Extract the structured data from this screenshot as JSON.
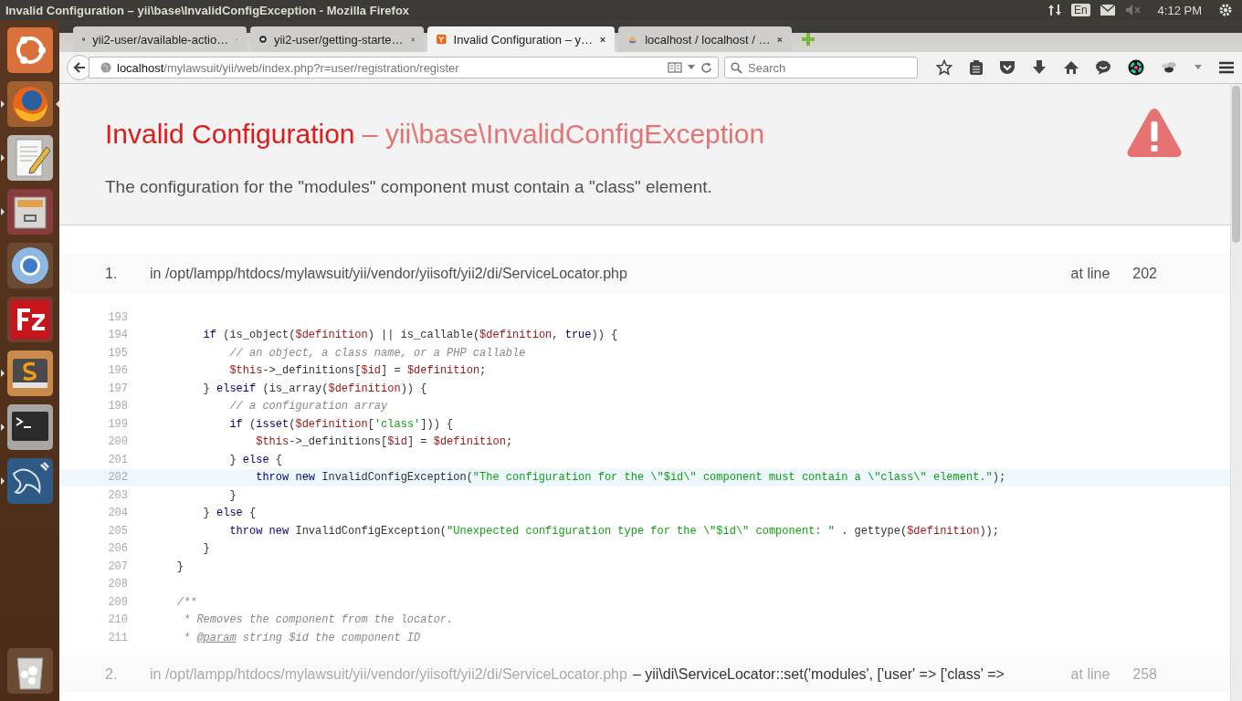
{
  "system_bar": {
    "title": "Invalid Configuration – yii\\base\\InvalidConfigException - Mozilla Firefox",
    "keyboard": "En",
    "clock": "4:12 PM"
  },
  "launcher": [
    {
      "kind": "home",
      "running": false,
      "focused": false
    },
    {
      "kind": "firefox",
      "running": true,
      "focused": true
    },
    {
      "kind": "editor",
      "running": true,
      "focused": false
    },
    {
      "kind": "files",
      "running": true,
      "focused": false
    },
    {
      "kind": "chromium",
      "running": false,
      "focused": false
    },
    {
      "kind": "filezilla",
      "running": false,
      "focused": false
    },
    {
      "kind": "sublime",
      "running": true,
      "focused": false
    },
    {
      "kind": "terminal",
      "running": true,
      "focused": false
    },
    {
      "kind": "workbench",
      "running": true,
      "focused": false
    },
    {
      "kind": "trash",
      "running": false,
      "focused": false
    }
  ],
  "tabs": [
    {
      "label": "yii2-user/available-actio…",
      "kind": "github",
      "selected": false
    },
    {
      "label": "yii2-user/getting-starte…",
      "kind": "github",
      "selected": false
    },
    {
      "label": "Invalid Configuration – y…",
      "kind": "yii",
      "selected": true
    },
    {
      "label": "localhost / localhost / …",
      "kind": "pma",
      "selected": false
    }
  ],
  "address_bar": {
    "host": "localhost",
    "path": "/mylawsuit/yii/web/index.php?r=user/registration/register"
  },
  "search": {
    "placeholder": "Search"
  },
  "error": {
    "name": "Invalid Configuration",
    "exception": "– yii\\base\\InvalidConfigException",
    "message": "The configuration for the \"modules\" component must contain a \"class\" element."
  },
  "call_stack": [
    {
      "number": "1.",
      "file": "in /opt/lampp/htdocs/mylawsuit/yii/vendor/yiisoft/yii2/di/ServiceLocator.php",
      "line_label": "at line",
      "line": "202",
      "code": [
        {
          "number": "193",
          "highlighted": false
        },
        {
          "number": "194",
          "highlighted": false,
          "tokens": [
            {
              "kind": "keyword",
              "text": "        if"
            },
            {
              "kind": "plain",
              "text": " (is_object("
            },
            {
              "kind": "variable",
              "text": "$definition"
            },
            {
              "kind": "plain",
              "text": ") || is_callable("
            },
            {
              "kind": "variable",
              "text": "$definition"
            },
            {
              "kind": "plain",
              "text": ", "
            },
            {
              "kind": "keyword",
              "text": "true"
            },
            {
              "kind": "plain",
              "text": ")) {"
            }
          ]
        },
        {
          "number": "195",
          "highlighted": false,
          "tokens": [
            {
              "kind": "comment",
              "text": "            // an object, a class name, or a PHP callable"
            }
          ]
        },
        {
          "number": "196",
          "highlighted": false,
          "tokens": [
            {
              "kind": "variable",
              "text": "            $this"
            },
            {
              "kind": "plain",
              "text": "->_definitions["
            },
            {
              "kind": "variable",
              "text": "$id"
            },
            {
              "kind": "plain",
              "text": "] = "
            },
            {
              "kind": "variable",
              "text": "$definition"
            },
            {
              "kind": "plain",
              "text": ";"
            }
          ]
        },
        {
          "number": "197",
          "highlighted": false,
          "tokens": [
            {
              "kind": "plain",
              "text": "        } "
            },
            {
              "kind": "keyword",
              "text": "elseif"
            },
            {
              "kind": "plain",
              "text": " (is_array("
            },
            {
              "kind": "variable",
              "text": "$definition"
            },
            {
              "kind": "plain",
              "text": ")) {"
            }
          ]
        },
        {
          "number": "198",
          "highlighted": false,
          "tokens": [
            {
              "kind": "comment",
              "text": "            // a configuration array"
            }
          ]
        },
        {
          "number": "199",
          "highlighted": false,
          "tokens": [
            {
              "kind": "keyword",
              "text": "            if"
            },
            {
              "kind": "plain",
              "text": " ("
            },
            {
              "kind": "keyword",
              "text": "isset"
            },
            {
              "kind": "plain",
              "text": "("
            },
            {
              "kind": "variable",
              "text": "$definition"
            },
            {
              "kind": "plain",
              "text": "["
            },
            {
              "kind": "string",
              "text": "'class'"
            },
            {
              "kind": "plain",
              "text": "])) {"
            }
          ]
        },
        {
          "number": "200",
          "highlighted": false,
          "tokens": [
            {
              "kind": "variable",
              "text": "                $this"
            },
            {
              "kind": "plain",
              "text": "->_definitions["
            },
            {
              "kind": "variable",
              "text": "$id"
            },
            {
              "kind": "plain",
              "text": "] = "
            },
            {
              "kind": "variable",
              "text": "$definition"
            },
            {
              "kind": "plain",
              "text": ";"
            }
          ]
        },
        {
          "number": "201",
          "highlighted": false,
          "tokens": [
            {
              "kind": "plain",
              "text": "            } "
            },
            {
              "kind": "keyword",
              "text": "else"
            },
            {
              "kind": "plain",
              "text": " {"
            }
          ]
        },
        {
          "number": "202",
          "highlighted": true,
          "tokens": [
            {
              "kind": "keyword",
              "text": "                throw new"
            },
            {
              "kind": "plain",
              "text": " InvalidConfigException("
            },
            {
              "kind": "string",
              "text": "\"The configuration for the \\\"$id\\\" component must contain a \\\"class\\\" element.\""
            },
            {
              "kind": "plain",
              "text": ");"
            }
          ]
        },
        {
          "number": "203",
          "highlighted": false,
          "tokens": [
            {
              "kind": "plain",
              "text": "            }"
            }
          ]
        },
        {
          "number": "204",
          "highlighted": false,
          "tokens": [
            {
              "kind": "plain",
              "text": "        } "
            },
            {
              "kind": "keyword",
              "text": "else"
            },
            {
              "kind": "plain",
              "text": " {"
            }
          ]
        },
        {
          "number": "205",
          "highlighted": false,
          "tokens": [
            {
              "kind": "keyword",
              "text": "            throw new"
            },
            {
              "kind": "plain",
              "text": " InvalidConfigException("
            },
            {
              "kind": "string",
              "text": "\"Unexpected configuration type for the \\\"$id\\\" component: \""
            },
            {
              "kind": "plain",
              "text": " . gettype("
            },
            {
              "kind": "variable",
              "text": "$definition"
            },
            {
              "kind": "plain",
              "text": "));"
            }
          ]
        },
        {
          "number": "206",
          "highlighted": false,
          "tokens": [
            {
              "kind": "plain",
              "text": "        }"
            }
          ]
        },
        {
          "number": "207",
          "highlighted": false,
          "tokens": [
            {
              "kind": "plain",
              "text": "    }"
            }
          ]
        },
        {
          "number": "208",
          "highlighted": false
        },
        {
          "number": "209",
          "highlighted": false,
          "tokens": [
            {
              "kind": "comment",
              "text": "    /**"
            }
          ]
        },
        {
          "number": "210",
          "highlighted": false,
          "tokens": [
            {
              "kind": "comment",
              "text": "     * Removes the component from the locator."
            }
          ]
        },
        {
          "number": "211",
          "highlighted": false,
          "tokens": [
            {
              "kind": "comment",
              "text": "     * "
            },
            {
              "kind": "doctag",
              "text": "@param"
            },
            {
              "kind": "comment",
              "text": " string $id the component ID"
            }
          ]
        }
      ]
    },
    {
      "number": "2.",
      "file": "in /opt/lampp/htdocs/mylawsuit/yii/vendor/yiisoft/yii2/di/ServiceLocator.php",
      "call": "– yii\\di\\ServiceLocator::set('modules', ['user' => ['class' =>",
      "line_label": "at line",
      "line": "258"
    }
  ]
}
